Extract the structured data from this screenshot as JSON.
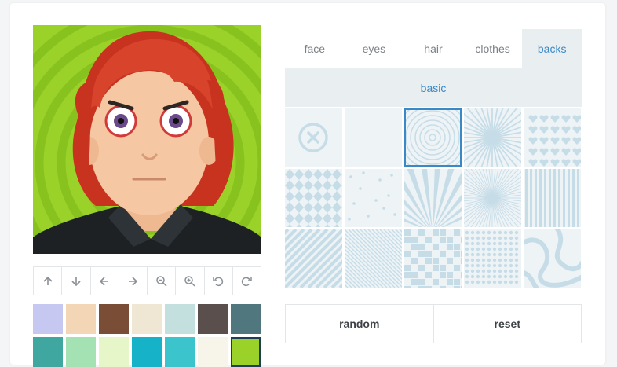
{
  "tabs": [
    {
      "label": "face"
    },
    {
      "label": "eyes"
    },
    {
      "label": "hair"
    },
    {
      "label": "clothes"
    },
    {
      "label": "backs",
      "active": true
    }
  ],
  "subcategory": "basic",
  "toolbar": [
    {
      "icon": "arrow-up-icon"
    },
    {
      "icon": "arrow-down-icon"
    },
    {
      "icon": "arrow-left-icon"
    },
    {
      "icon": "arrow-right-icon"
    },
    {
      "icon": "zoom-out-icon"
    },
    {
      "icon": "zoom-in-icon"
    },
    {
      "icon": "undo-icon"
    },
    {
      "icon": "redo-icon"
    }
  ],
  "swatches": [
    "#c6c8f2",
    "#f3d6b6",
    "#7a4e36",
    "#efe7d3",
    "#c3e0de",
    "#5b4f4e",
    "#50767e",
    "#3fa6a0",
    "#a4e2b4",
    "#e6f6c8",
    "#16b2c8",
    "#3cc4cc",
    "#f7f4ea",
    "#9bd22a"
  ],
  "selected_swatch": 13,
  "patterns": [
    "none",
    "plain",
    "concentric-circles",
    "sunburst",
    "hearts",
    "diamonds",
    "dots-scatter",
    "rays",
    "starburst",
    "vertical-stripes",
    "diagonal-stripes",
    "fine-diagonals",
    "squares-mosaic",
    "dot-grid",
    "curvy-lines"
  ],
  "selected_pattern": 2,
  "actions": {
    "random_label": "random",
    "reset_label": "reset"
  },
  "colors": {
    "accent": "#3a88c6",
    "background_green": "#9bd22a",
    "hair": "#d2402a",
    "pattern": "#c6dde8"
  }
}
